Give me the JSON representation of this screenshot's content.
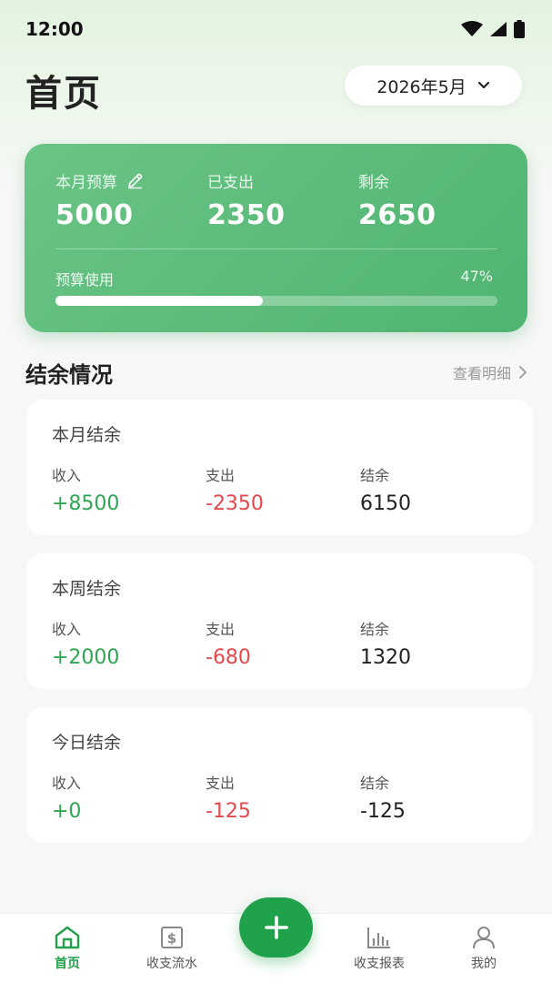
{
  "status": {
    "time": "12:00"
  },
  "header": {
    "title": "首页",
    "month": "2026年5月"
  },
  "budget": {
    "budget_label": "本月预算",
    "budget_value": "5000",
    "spent_label": "已支出",
    "spent_value": "2350",
    "remain_label": "剩余",
    "remain_value": "2650",
    "usage_label": "预算使用",
    "usage_percent": "47%",
    "usage_fraction": 0.47
  },
  "section": {
    "title": "结余情况",
    "link": "查看明细"
  },
  "cards": [
    {
      "title": "本月结余",
      "income_label": "收入",
      "income": "+8500",
      "expense_label": "支出",
      "expense": "-2350",
      "balance_label": "结余",
      "balance": "6150"
    },
    {
      "title": "本周结余",
      "income_label": "收入",
      "income": "+2000",
      "expense_label": "支出",
      "expense": "-680",
      "balance_label": "结余",
      "balance": "1320"
    },
    {
      "title": "今日结余",
      "income_label": "收入",
      "income": "+0",
      "expense_label": "支出",
      "expense": "-125",
      "balance_label": "结余",
      "balance": "-125"
    }
  ],
  "nav": [
    {
      "label": "首页",
      "icon": "home-icon"
    },
    {
      "label": "收支流水",
      "icon": "receipt-icon"
    },
    {
      "label": "收支报表",
      "icon": "bar-chart-icon"
    },
    {
      "label": "我的",
      "icon": "user-icon"
    }
  ],
  "colors": {
    "accent": "#1fa24b",
    "income": "#2ea653",
    "expense": "#e5484d"
  }
}
